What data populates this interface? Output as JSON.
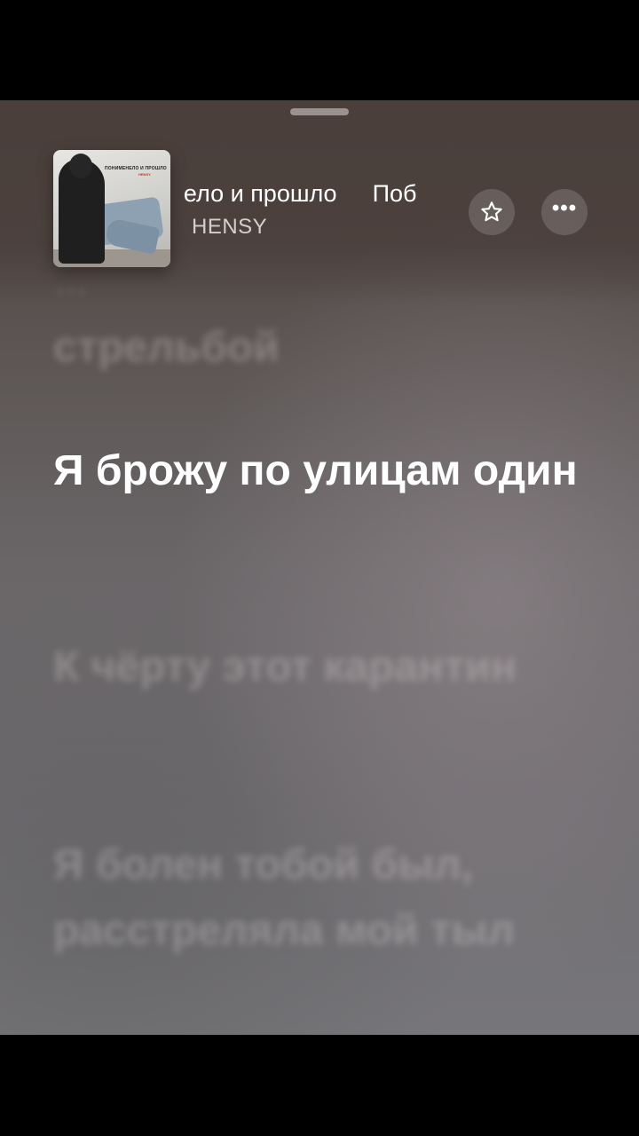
{
  "now_playing": {
    "song_title_visible": "нело и прошло",
    "song_title_next_fragment": "Поб",
    "artist": "HENSY",
    "artwork": {
      "title": "ПОНИМЕНЕЛО И ПРОШЛО",
      "artist": "HENSY"
    }
  },
  "controls": {
    "favorite_icon": "star-icon",
    "more_icon": "ellipsis-icon",
    "more_label": "•••"
  },
  "lyrics": {
    "previous_partial": "…",
    "previous": "стрельбой",
    "current": "Я брожу по улицам один",
    "next": [
      "К чёрту этот карантин",
      "Я болен тобой был, расстреляла мой тыл"
    ]
  }
}
